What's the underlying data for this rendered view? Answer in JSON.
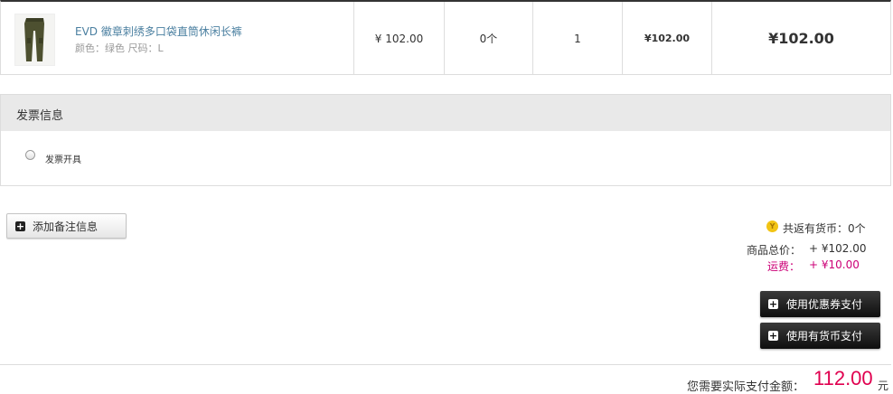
{
  "product": {
    "name": "EVD 徽章刺绣多口袋直筒休闲长裤",
    "attributes": "颜色：绿色 尺码：L",
    "image_icon": "pants-thumbnail",
    "unit_price": "¥ 102.00",
    "discount": "0个",
    "quantity": "1",
    "subtotal": "¥102.00",
    "total": "¥102.00"
  },
  "invoice": {
    "title": "发票信息",
    "option_label": "发票开具"
  },
  "remark": {
    "button_label": "添加备注信息"
  },
  "summary": {
    "coin_icon_glyph": "Y",
    "coin_return": "共返有货币：0个",
    "goods_total_label": "商品总价：",
    "goods_total_value": "+ ¥102.00",
    "shipping_label": "运费：",
    "shipping_value": "+ ¥10.00",
    "coupon_button": "使用优惠券支付",
    "currency_button": "使用有货币支付"
  },
  "payment": {
    "label": "您需要实际支付金额：",
    "amount": "112.00",
    "unit": "元"
  },
  "colors": {
    "link_blue": "#4a7fa0",
    "accent_pink": "#e0004f",
    "shipping_pink": "#cc0077"
  }
}
